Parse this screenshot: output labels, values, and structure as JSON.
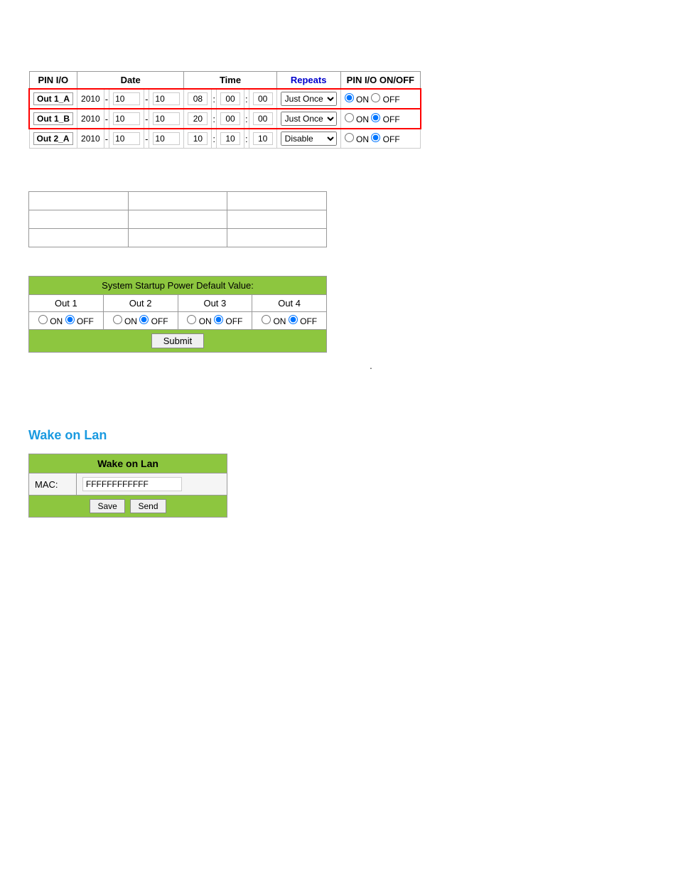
{
  "scheduler": {
    "headers": {
      "pin_io": "PIN I/O",
      "date": "Date",
      "time": "Time",
      "repeats": "Repeats",
      "pin_onoff": "PIN I/O ON/OFF"
    },
    "rows": [
      {
        "id": "row1",
        "pin": "Out 1_A",
        "year": "2010",
        "month": "10",
        "day": "10",
        "hour": "08",
        "min": "00",
        "sec": "00",
        "repeats": "Just Once",
        "state": "ON",
        "highlight": true
      },
      {
        "id": "row2",
        "pin": "Out 1_B",
        "year": "2010",
        "month": "10",
        "day": "10",
        "hour": "20",
        "min": "00",
        "sec": "00",
        "repeats": "Just Once",
        "state": "OFF",
        "highlight": true
      },
      {
        "id": "row3",
        "pin": "Out 2_A",
        "year": "2010",
        "month": "10",
        "day": "10",
        "hour": "10",
        "min": "10",
        "sec": "10",
        "repeats": "Disable",
        "state": "OFF",
        "highlight": false
      }
    ],
    "repeats_options": [
      "Repeats",
      "Just Once",
      "Disable"
    ]
  },
  "startup": {
    "title": "System Startup Power Default Value:",
    "columns": [
      "Out 1",
      "Out 2",
      "Out 3",
      "Out 4"
    ],
    "values": [
      {
        "label": "Out 1",
        "state": "OFF"
      },
      {
        "label": "Out 2",
        "state": "OFF"
      },
      {
        "label": "Out 3",
        "state": "OFF"
      },
      {
        "label": "Out 4",
        "state": "OFF"
      }
    ],
    "submit_label": "Submit"
  },
  "dot": ".",
  "wol": {
    "title": "Wake on Lan",
    "table_header": "Wake on Lan",
    "mac_label": "MAC:",
    "mac_value": "FFFFFFFFFFFF",
    "save_label": "Save",
    "send_label": "Send"
  }
}
